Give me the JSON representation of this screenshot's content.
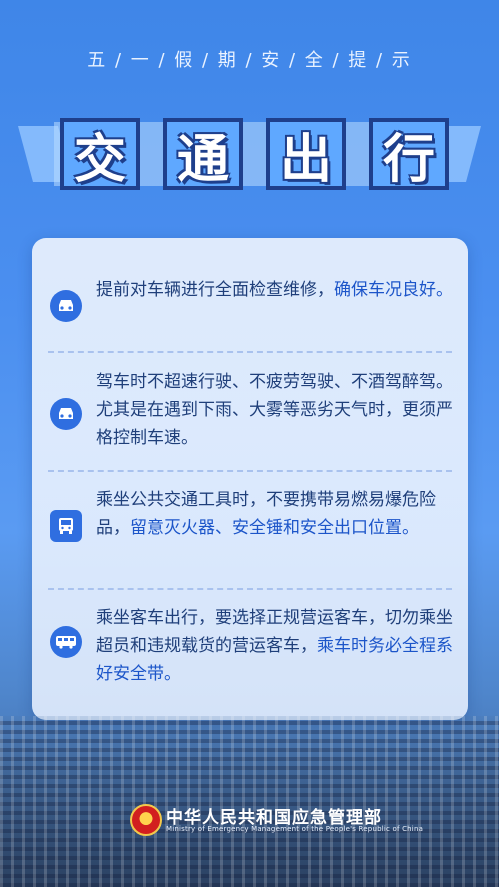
{
  "header": {
    "subtitle": "五 / 一 / 假 / 期 / 安 / 全 / 提 / 示",
    "title_chars": [
      "交",
      "通",
      "出",
      "行"
    ]
  },
  "tips": [
    {
      "icon": "car-front-icon",
      "parts": [
        {
          "text": "提前对车辆进行全面检查维修，",
          "highlight": false
        },
        {
          "text": "确保车况良好。",
          "highlight": true
        }
      ]
    },
    {
      "icon": "car-front-icon",
      "parts": [
        {
          "text": "驾车时不超速行驶、不疲劳驾驶、不酒驾醉驾。尤其是在遇到下雨、大雾等恶劣天气时，更须严格控制车速。",
          "highlight": false
        }
      ]
    },
    {
      "icon": "bus-icon",
      "parts": [
        {
          "text": "乘坐公共交通工具时，不要携带易燃易爆危险品，",
          "highlight": false
        },
        {
          "text": "留意灭火器、安全锤和安全出口位置。",
          "highlight": true
        }
      ]
    },
    {
      "icon": "coach-icon",
      "parts": [
        {
          "text": "乘坐客车出行，要选择正规营运客车，切勿乘坐超员和违规载货的营运客车，",
          "highlight": false
        },
        {
          "text": "乘车时务必全程系好安全带。",
          "highlight": true
        }
      ]
    }
  ],
  "footer": {
    "org_name": "中华人民共和国应急管理部",
    "org_name_en": "Ministry of Emergency Management of the People's Republic of China"
  },
  "colors": {
    "background": "#4b8ff0",
    "highlight": "#1c55c9",
    "text": "#1f3f7a",
    "title_outline": "#1e3f8c"
  }
}
